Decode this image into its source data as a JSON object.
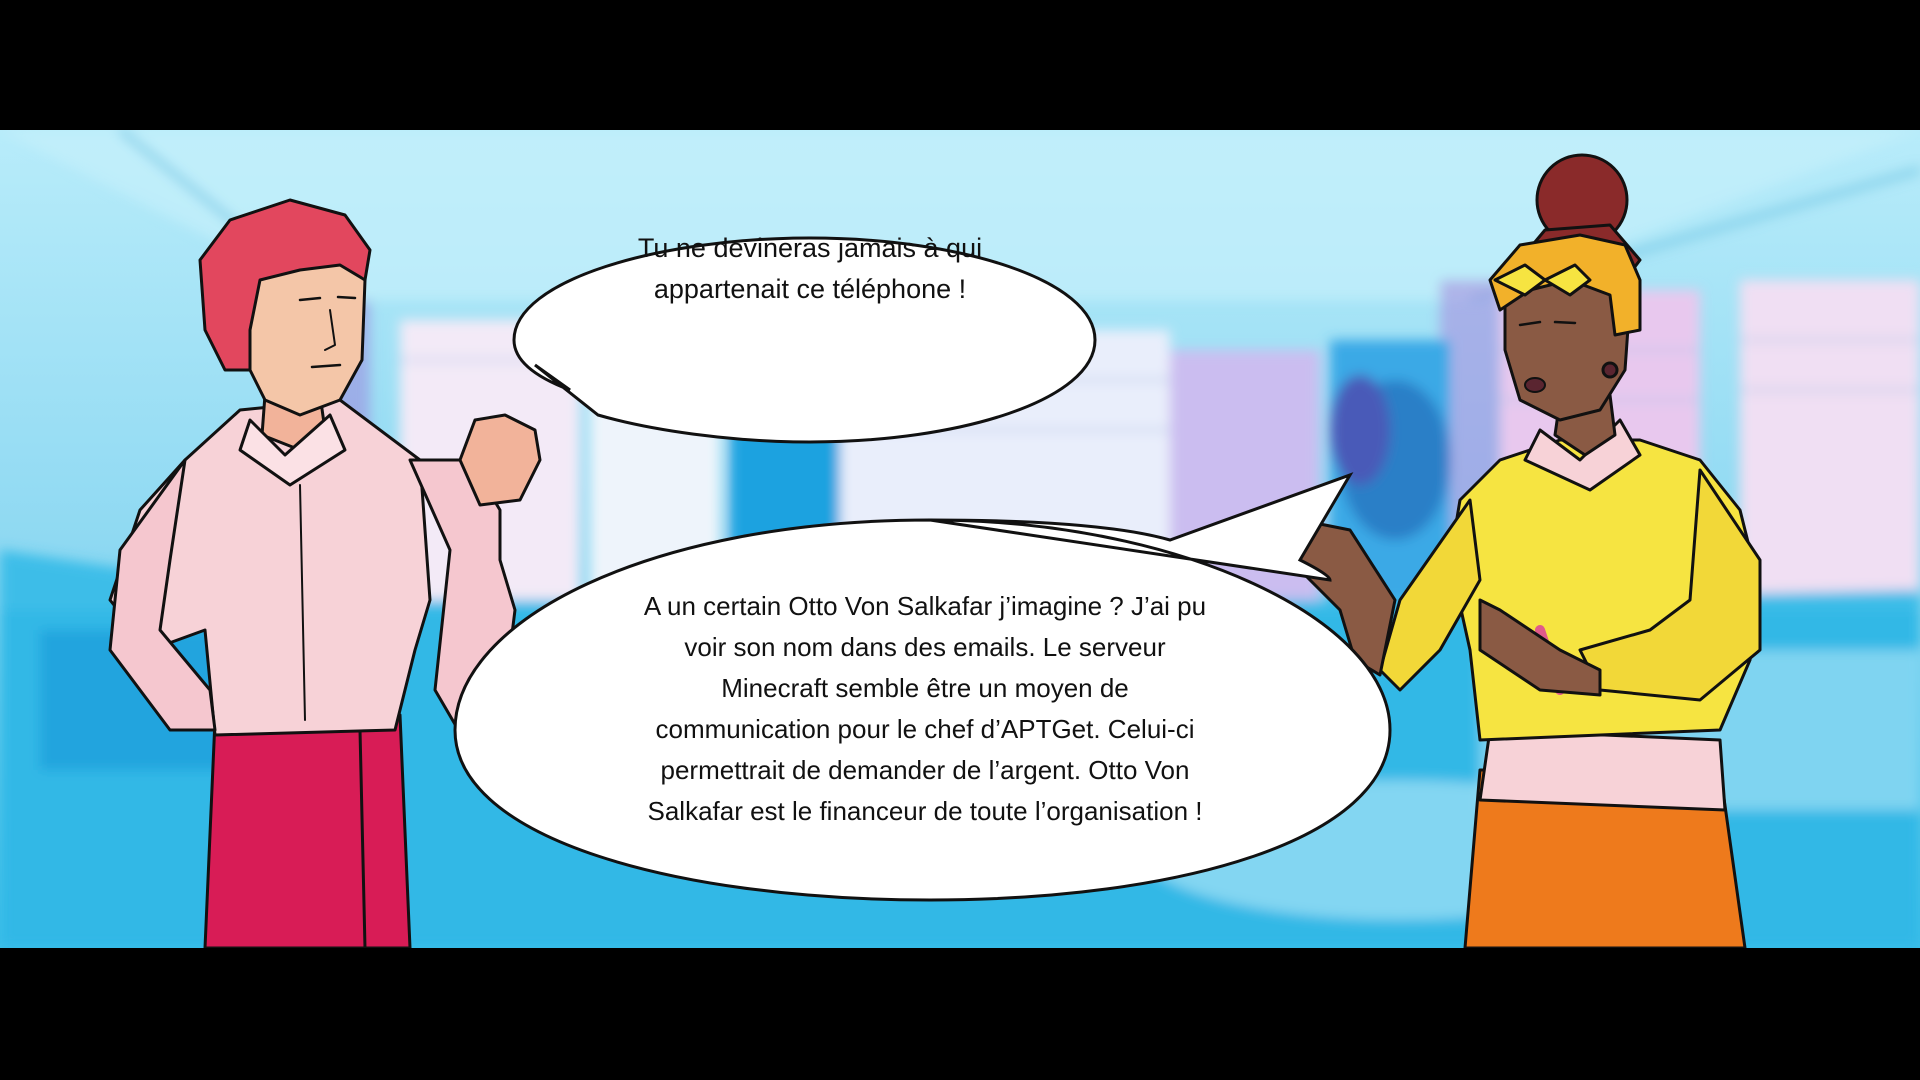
{
  "scene": {
    "palette": {
      "sky": "#4fc7ec",
      "wall": "#8fd9f2",
      "floor": "#2cb6e4",
      "violet": "#a78fe0",
      "left_character_hair": "#e2475e",
      "left_character_shirt": "#f7d2d7",
      "left_character_pants": "#d81c56",
      "right_character_hair": "#8a2a2a",
      "right_character_headband": "#f2b12a",
      "right_character_skin": "#8a5a44",
      "right_character_sweater": "#f6e441",
      "right_character_pants": "#ee7a1c",
      "bubble_fill": "#ffffff",
      "bubble_stroke": "#111111"
    }
  },
  "dialogue": {
    "bubble1": {
      "speaker": "left",
      "lines": [
        "Tu ne devineras jamais à qui",
        "appartenait ce téléphone !"
      ]
    },
    "bubble2": {
      "speaker": "right",
      "lines": [
        "A un certain Otto Von Salkafar j’imagine ? J’ai pu",
        "voir son nom dans des emails. Le serveur",
        "Minecraft semble être un moyen de",
        "communication pour le chef d’APTGet. Celui-ci",
        "permettrait de demander de l’argent. Otto Von",
        "Salkafar est le financeur de toute l’organisation !"
      ]
    }
  }
}
